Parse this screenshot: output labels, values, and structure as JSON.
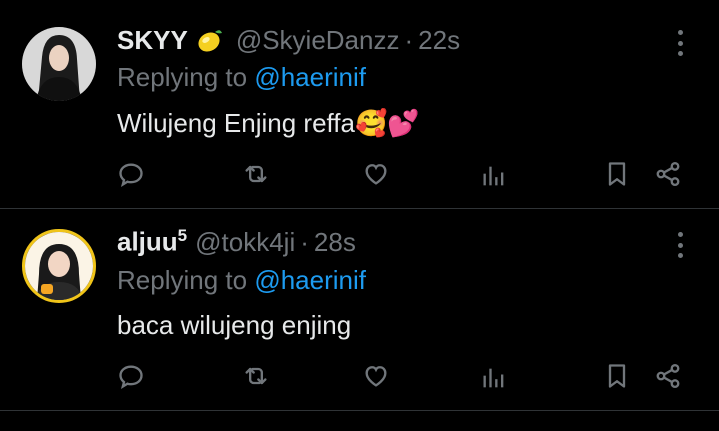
{
  "tweets": [
    {
      "name": "SKYY",
      "name_suffix": "",
      "handle": "@SkyieDanzz",
      "separator": "·",
      "time": "22s",
      "replying_prefix": "Replying to",
      "replying_to": "@haerinif",
      "text": "Wilujeng Enjing reffa",
      "text_emojis": "🥰💕"
    },
    {
      "name": "aljuu",
      "name_suffix": "5",
      "handle": "@tokk4ji",
      "separator": "·",
      "time": "28s",
      "replying_prefix": "Replying to",
      "replying_to": "@haerinif",
      "text": "baca wilujeng enjing",
      "text_emojis": ""
    }
  ],
  "icons": {
    "actions": [
      "reply-icon",
      "retweet-icon",
      "like-icon",
      "views-icon",
      "bookmark-icon",
      "share-icon"
    ],
    "name_badge": "lemon-icon"
  },
  "colors": {
    "background": "#000000",
    "text": "#e7e9ea",
    "muted": "#71767b",
    "mention": "#1d9bf0",
    "divider": "#2f3336"
  }
}
